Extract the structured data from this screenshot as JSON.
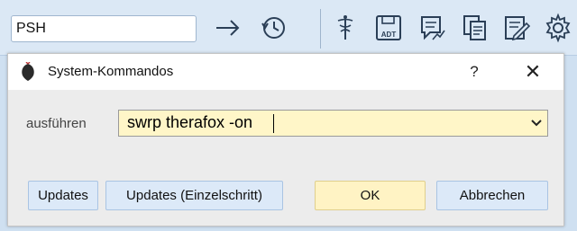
{
  "toolbar": {
    "command_input_value": "PSH",
    "icons": [
      "arrow-right-icon",
      "history-icon",
      "caduceus-icon",
      "adt-save-icon",
      "chart-note-icon",
      "copy-documents-icon",
      "edit-note-icon",
      "gear-icon"
    ],
    "adt_label": "ADT"
  },
  "dialog": {
    "title": "System-Kommandos",
    "help_label": "?",
    "close_label": "✕",
    "exec_label": "ausführen",
    "exec_value": "swrp therafox -on",
    "buttons": {
      "updates": "Updates",
      "updates_step": "Updates (Einzelschritt)",
      "ok": "OK",
      "cancel": "Abbrechen"
    }
  },
  "colors": {
    "toolbar_bg": "#dbe8f5",
    "dialog_body_bg": "#ececec",
    "combo_bg": "#fff6c8",
    "ok_button_bg": "#fff3c4",
    "button_bg": "#dce9f8",
    "icon_stroke": "#2b3f57"
  }
}
